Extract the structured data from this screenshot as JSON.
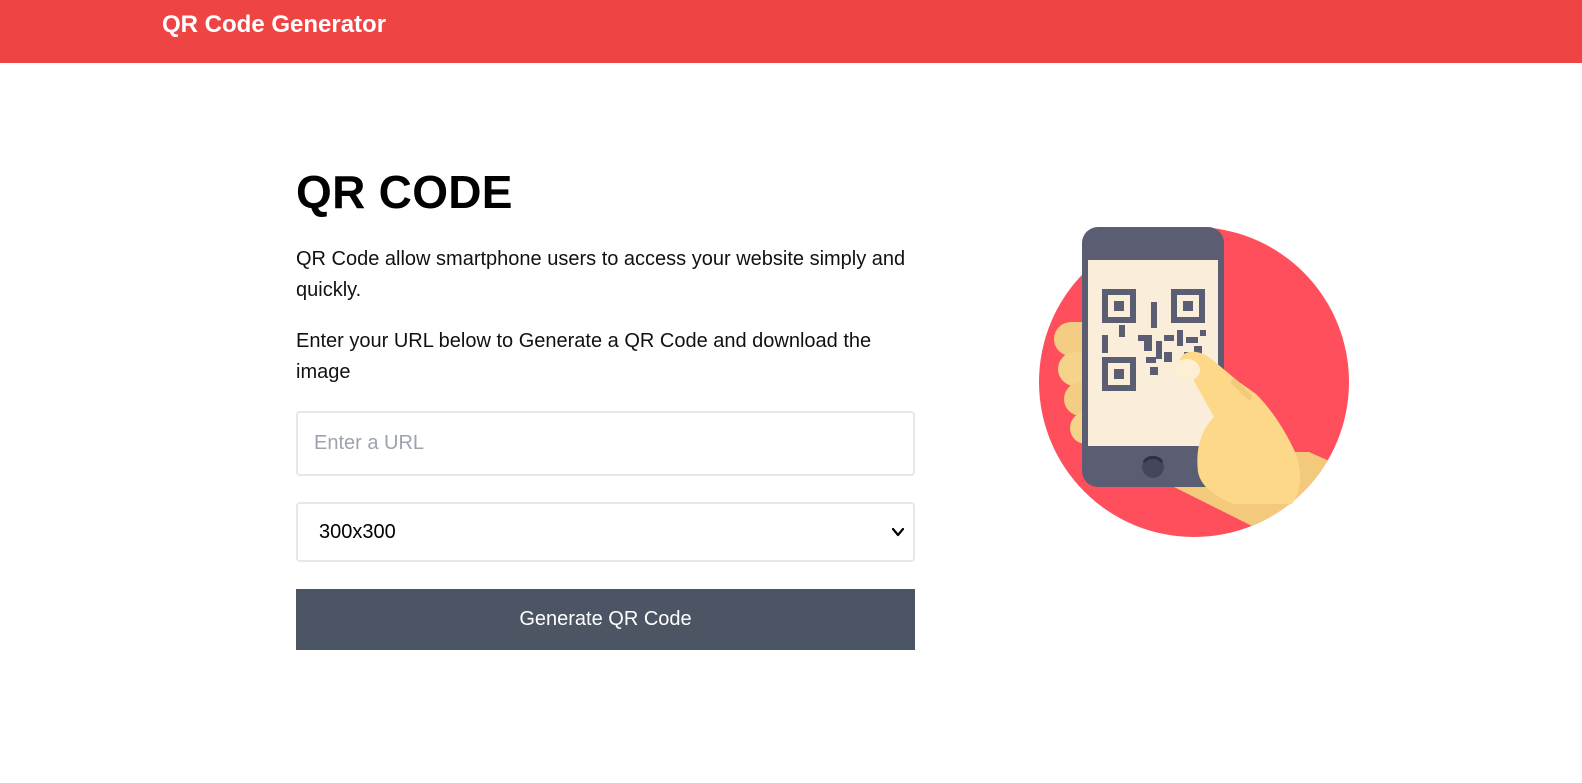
{
  "header": {
    "brand": "QR Code Generator"
  },
  "main": {
    "title": "QR CODE",
    "description1": "QR Code allow smartphone users to access your website simply and quickly.",
    "description2": "Enter your URL below to Generate a QR Code and download the image",
    "url_input": {
      "value": "",
      "placeholder": "Enter a URL"
    },
    "size_select": {
      "selected": "300x300"
    },
    "generate_label": "Generate QR Code"
  },
  "illustration": {
    "icon": "phone-scanning-qr-icon"
  },
  "colors": {
    "header": "#ef4444",
    "button": "#4b5563",
    "circle": "#ff4e5c",
    "phone": "#5b5e73",
    "screen": "#faeedb",
    "hand": "#fdd888"
  }
}
